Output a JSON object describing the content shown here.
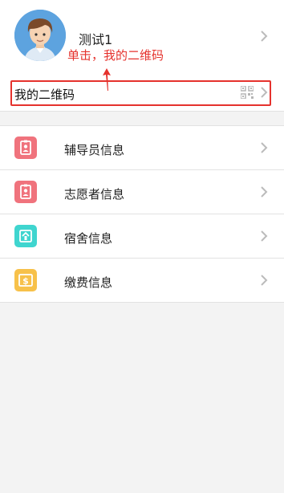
{
  "profile": {
    "username": "测试1",
    "avatar_icon": "user-avatar-cartoon",
    "chevron_icon": "chevron-right-icon"
  },
  "annotation": {
    "text": "单击，我的二维码",
    "color": "#e5322d"
  },
  "qr_row": {
    "label": "我的二维码",
    "icon": "qr-code-icon",
    "chevron_icon": "chevron-right-icon"
  },
  "menu": {
    "items": [
      {
        "label": "辅导员信息",
        "icon": "id-badge-icon",
        "color": "#f0737d"
      },
      {
        "label": "志愿者信息",
        "icon": "id-badge-icon",
        "color": "#f0737d"
      },
      {
        "label": "宿舍信息",
        "icon": "dorm-icon",
        "color": "#3fd5cf"
      },
      {
        "label": "缴费信息",
        "icon": "payment-icon",
        "color": "#f7c14a"
      }
    ]
  },
  "colors": {
    "page_bg": "#f3f3f3",
    "card_bg": "#ffffff",
    "divider": "#e2e2e2",
    "chevron": "#bbbbbb"
  }
}
